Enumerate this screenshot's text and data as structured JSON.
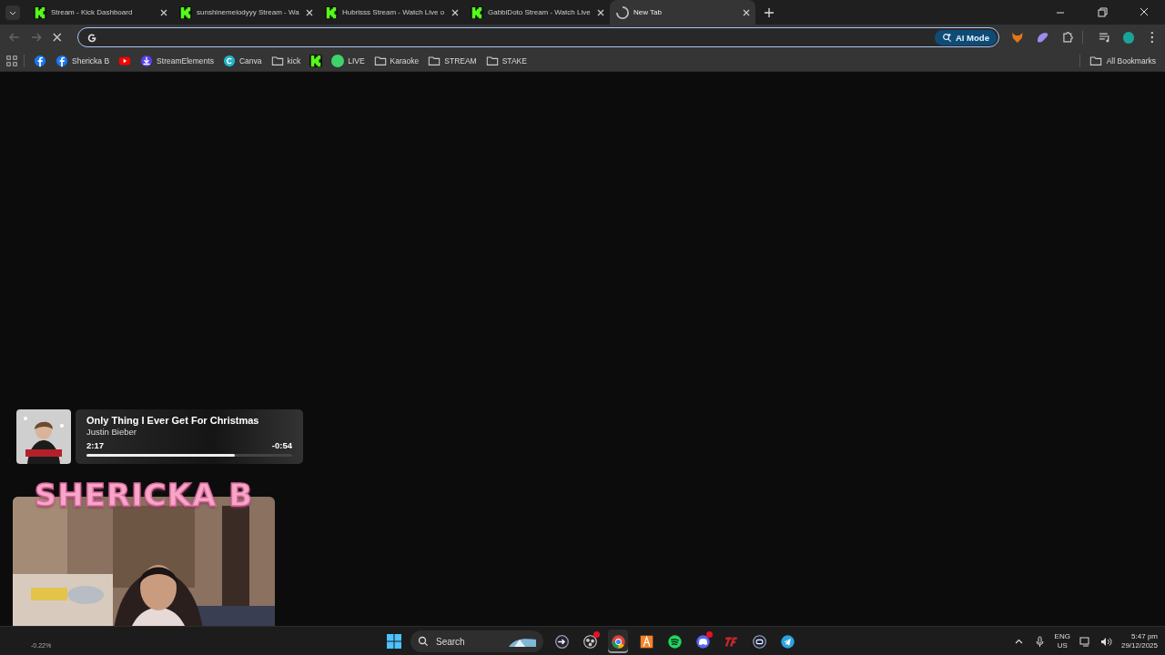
{
  "tabs": [
    {
      "label": "Stream - Kick Dashboard",
      "kind": "kick",
      "selected": false
    },
    {
      "label": "sunshinemelodyyy Stream - Wa",
      "kind": "kick",
      "selected": false
    },
    {
      "label": "Hubrisss Stream - Watch Live o",
      "kind": "kick",
      "selected": false
    },
    {
      "label": "GabbiDoto Stream - Watch Live",
      "kind": "kick",
      "selected": false
    },
    {
      "label": "New Tab",
      "kind": "loading",
      "selected": true
    }
  ],
  "address_bar": {
    "ai_mode": "AI Mode"
  },
  "bookmarks": [
    {
      "kind": "facebook"
    },
    {
      "kind": "facebook",
      "label": "Shericka B"
    },
    {
      "kind": "youtube"
    },
    {
      "kind": "streamelements",
      "label": "StreamElements"
    },
    {
      "kind": "canva",
      "label": "Canva"
    },
    {
      "kind": "folder",
      "label": "kick"
    },
    {
      "kind": "kick"
    },
    {
      "kind": "dot",
      "label": "LIVE"
    },
    {
      "kind": "folder",
      "label": "Karaoke"
    },
    {
      "kind": "folder",
      "label": "STREAM"
    },
    {
      "kind": "folder",
      "label": "STAKE"
    }
  ],
  "all_bookmarks": "All Bookmarks",
  "now_playing": {
    "title": "Only Thing I Ever Get For Christmas",
    "artist": "Justin Bieber",
    "elapsed": "2:17",
    "remaining": "-0:54",
    "level": 0.72
  },
  "webcam": {
    "title": "SHERICKA B"
  },
  "taskbar": {
    "search": "Search",
    "stock": "-0.22%",
    "language": "ENG",
    "region": "US",
    "time": "5:47 pm",
    "date": "29/12/2025",
    "apps": [
      {
        "kind": "arrow",
        "selected": false
      },
      {
        "kind": "obs",
        "badge": true,
        "selected": false
      },
      {
        "kind": "chrome",
        "selected": true
      },
      {
        "kind": "orange",
        "selected": false
      },
      {
        "kind": "spotify",
        "selected": false
      },
      {
        "kind": "discord",
        "badge": true,
        "selected": false
      },
      {
        "kind": "tf",
        "selected": false
      },
      {
        "kind": "round",
        "selected": false
      },
      {
        "kind": "telegram",
        "selected": false
      }
    ]
  }
}
